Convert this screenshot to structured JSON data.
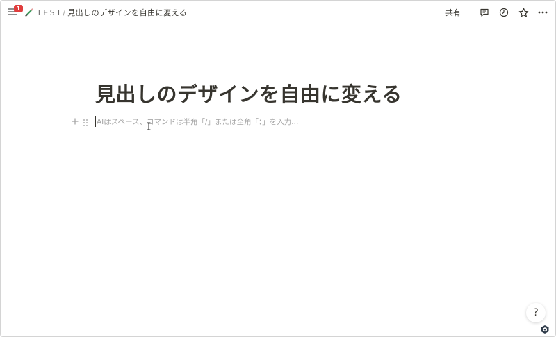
{
  "topbar": {
    "menu_icon": "hamburger-menu-icon",
    "badge_count": "1",
    "breadcrumb": {
      "workspace_icon": "pencil-icon",
      "workspace": "TEST",
      "separator": "/",
      "page": "見出しのデザインを自由に変える"
    },
    "share_label": "共有",
    "icons": [
      "comment-icon",
      "clock-icon",
      "star-icon",
      "more-icon"
    ]
  },
  "page": {
    "title": "見出しのデザインを自由に変える",
    "block_placeholder": "AIはスペース、コマンドは半角「/」または全角「：」を入力..."
  },
  "help": {
    "label": "?"
  },
  "colors": {
    "text": "#37352f",
    "placeholder": "#a6a6a6",
    "badge": "#e03e3e"
  }
}
